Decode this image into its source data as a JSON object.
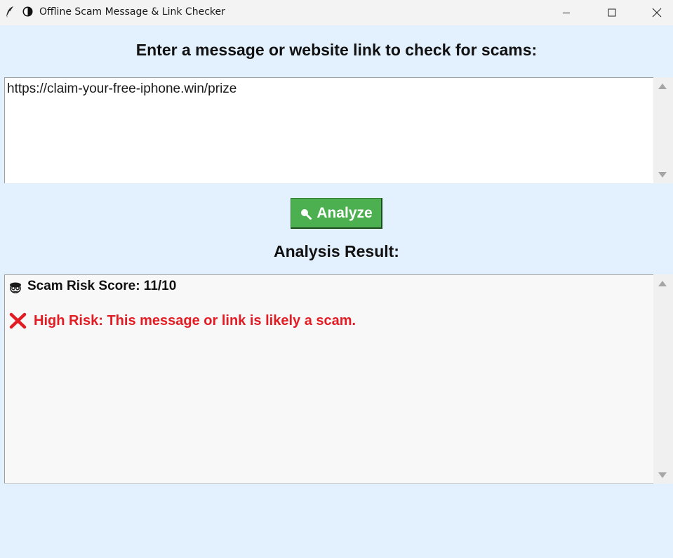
{
  "window": {
    "title": "Offline Scam Message & Link Checker",
    "icons": [
      "feather-icon",
      "contrast-icon"
    ],
    "controls": [
      "minimize-icon",
      "maximize-icon",
      "close-icon"
    ]
  },
  "prompt": "Enter a message or website link to check for scams:",
  "input": {
    "value": "https://claim-your-free-iphone.win/prize"
  },
  "analyze_button": {
    "label": "Analyze",
    "icon": "magnifier-icon",
    "color": "#4caf50"
  },
  "result": {
    "heading": "Analysis Result:",
    "score_icon": "detective-icon",
    "score_text": "Scam Risk Score: 11/10",
    "risk_icon": "red-x-icon",
    "risk_text": "High Risk: This message or link is likely a scam.",
    "risk_color": "#e31b23"
  },
  "colors": {
    "background": "#e3f0fd",
    "titlebar": "#f3f3f3"
  }
}
